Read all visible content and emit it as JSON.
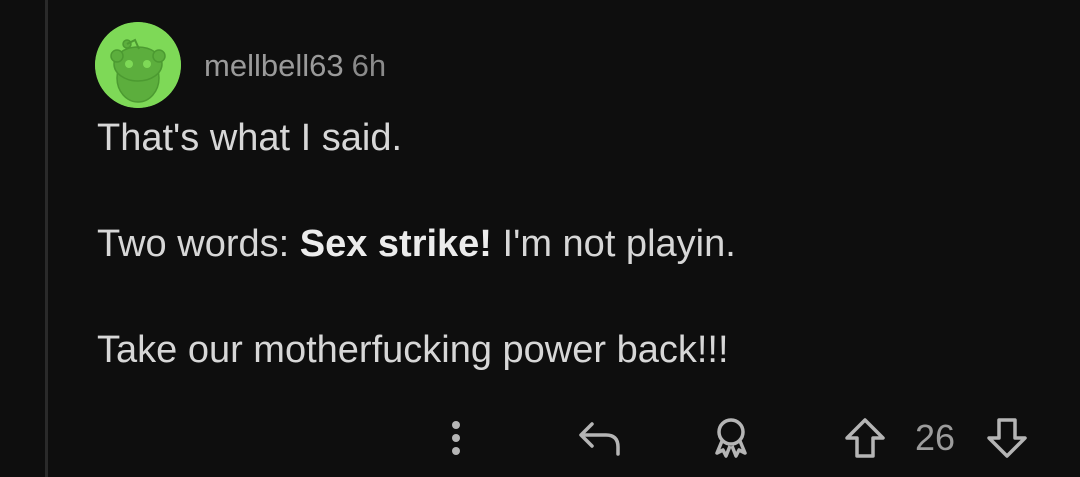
{
  "comment": {
    "username": "mellbell63",
    "time": "6h",
    "avatar_color": "#7ed957",
    "paragraphs": {
      "p1": "That's what I said.",
      "p2_prefix": "Two words: ",
      "p2_bold": "Sex strike!",
      "p2_suffix": " I'm not playin.",
      "p3": "Take our motherfucking power back!!!"
    },
    "score": "26"
  },
  "icons": {
    "avatar": "snoo-avatar-icon",
    "more": "more-vertical-icon",
    "reply": "reply-arrow-icon",
    "award": "award-icon",
    "upvote": "upvote-arrow-icon",
    "downvote": "downvote-arrow-icon"
  },
  "colors": {
    "background": "#0e0e0e",
    "text": "#d7d7d7",
    "muted": "#9a9a9a",
    "thread_line": "#2a2a2a"
  }
}
